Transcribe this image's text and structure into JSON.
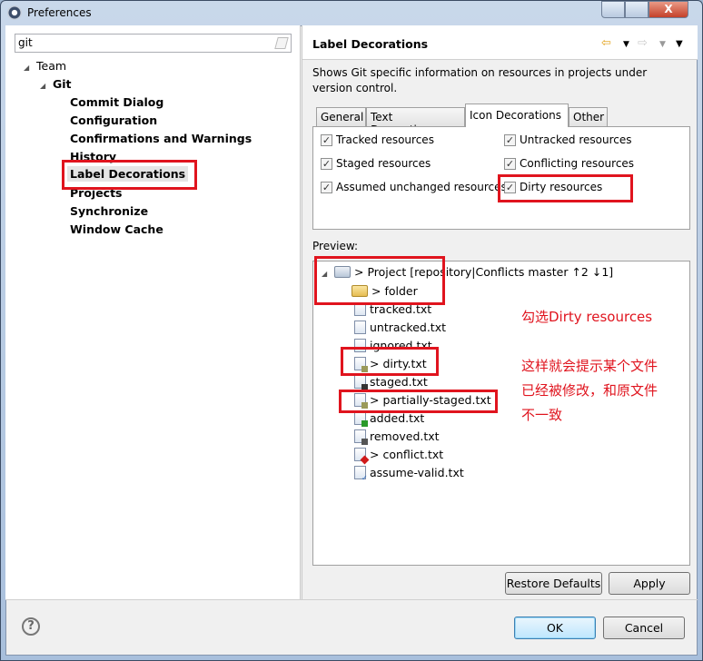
{
  "window": {
    "title": "Preferences",
    "close_label": "X"
  },
  "search": {
    "value": "git"
  },
  "tree": {
    "team": "Team",
    "git": "Git",
    "children": [
      "Commit Dialog",
      "Configuration",
      "Confirmations and Warnings",
      "History",
      "Label Decorations",
      "Projects",
      "Synchronize",
      "Window Cache"
    ]
  },
  "page": {
    "title": "Label Decorations",
    "description": "Shows Git specific information on resources in projects under version control."
  },
  "tabs": [
    "General",
    "Text Decorations",
    "Icon Decorations",
    "Other"
  ],
  "selected_tab": "Icon Decorations",
  "checkboxes": [
    {
      "label": "Tracked resources",
      "checked": true
    },
    {
      "label": "Untracked resources",
      "checked": true
    },
    {
      "label": "Staged resources",
      "checked": true
    },
    {
      "label": "Conflicting resources",
      "checked": true
    },
    {
      "label": "Assumed unchanged resources",
      "checked": true
    },
    {
      "label": "Dirty resources",
      "checked": true
    }
  ],
  "preview": {
    "label": "Preview:",
    "items": [
      "> Project [repository|Conflicts master ↑2 ↓1]",
      "> folder",
      "tracked.txt",
      "untracked.txt",
      "ignored.txt",
      "> dirty.txt",
      "staged.txt",
      "> partially-staged.txt",
      "added.txt",
      "removed.txt",
      "> conflict.txt",
      "assume-valid.txt"
    ]
  },
  "annotations": [
    "勾选Dirty resources",
    "这样就会提示某个文件",
    "已经被修改，和原文件",
    "不一致"
  ],
  "buttons": {
    "restore": "Restore Defaults",
    "apply": "Apply",
    "ok": "OK",
    "cancel": "Cancel",
    "help": "?"
  },
  "colors": {
    "highlight": "#e0141e"
  }
}
